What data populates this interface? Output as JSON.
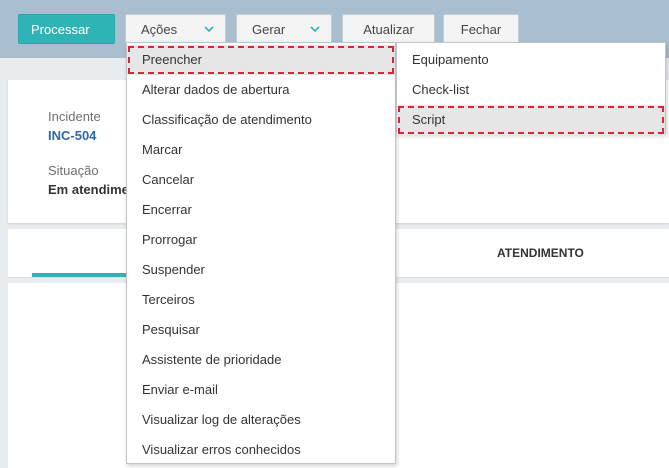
{
  "toolbar": {
    "processar": "Processar",
    "acoes": "Ações",
    "gerar": "Gerar",
    "atualizar": "Atualizar",
    "fechar": "Fechar"
  },
  "record": {
    "incidente_label": "Incidente",
    "incidente_value": "INC-504",
    "situacao_label": "Situação",
    "situacao_value": "Em atendime"
  },
  "tabs": {
    "atendimento": "ATENDIMENTO"
  },
  "acoes_menu": [
    "Preencher",
    "Alterar dados de abertura",
    "Classificação de atendimento",
    "Marcar",
    "Cancelar",
    "Encerrar",
    "Prorrogar",
    "Suspender",
    "Terceiros",
    "Pesquisar",
    "Assistente de prioridade",
    "Enviar e-mail",
    "Visualizar log de alterações",
    "Visualizar erros conhecidos"
  ],
  "preencher_submenu": [
    "Equipamento",
    "Check-list",
    "Script"
  ],
  "colors": {
    "toolbar_bg": "#a9bfcf",
    "accent": "#2fb4b5",
    "link": "#2d6aa3",
    "focus_outline": "#d9263a"
  }
}
